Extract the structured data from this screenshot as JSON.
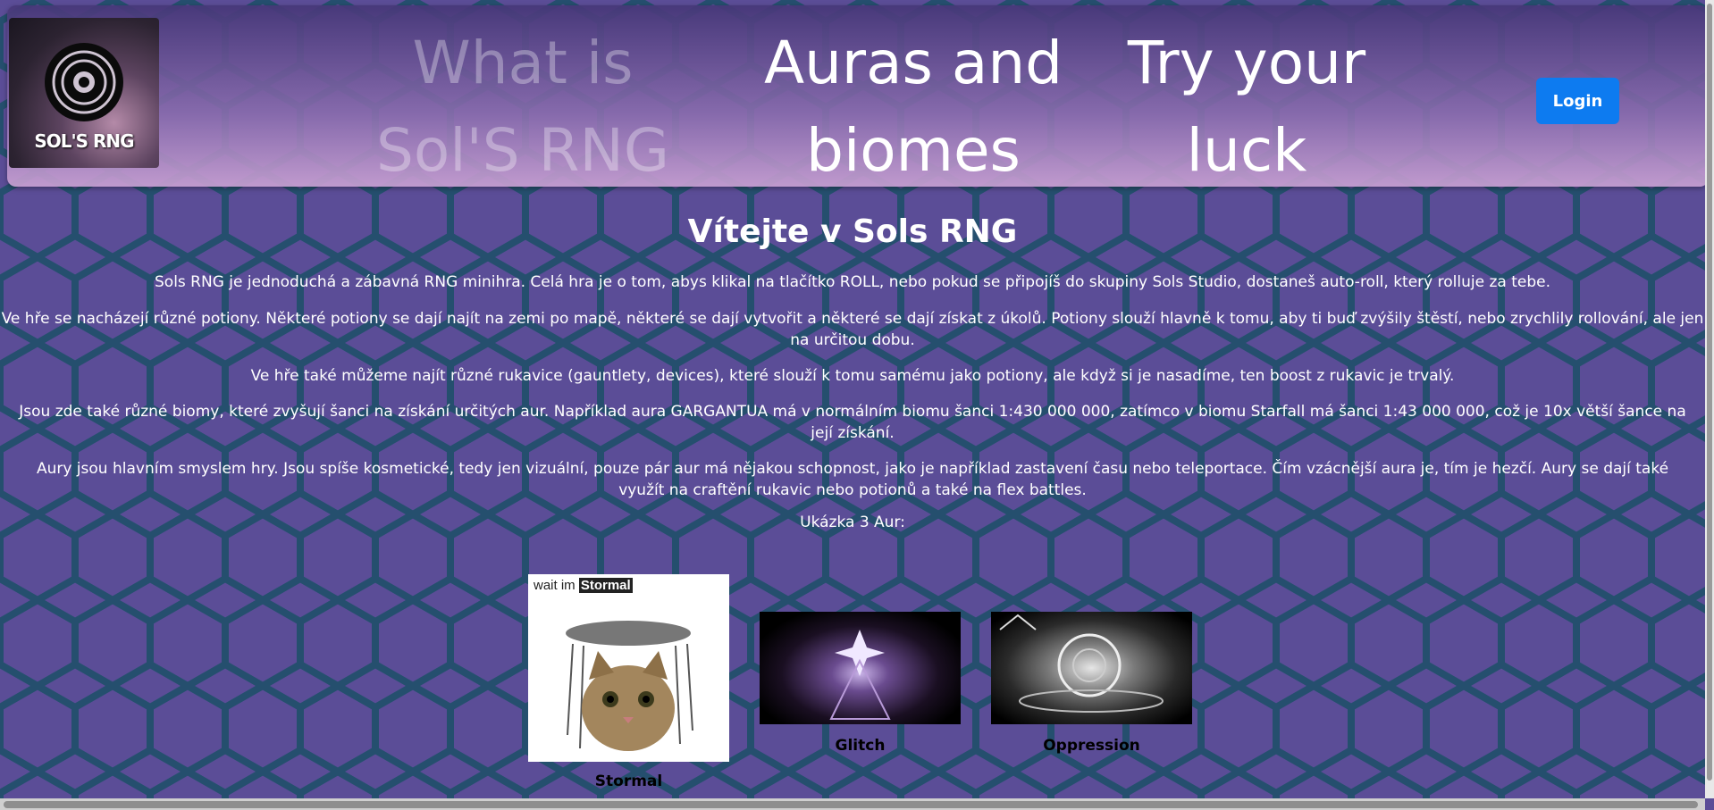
{
  "header": {
    "logo_text": "SOL'S RNG",
    "nav": [
      {
        "label": "What is Sol'S RNG"
      },
      {
        "label": "Auras and biomes"
      },
      {
        "label": "Try your luck"
      }
    ],
    "login_label": "Login",
    "colors": {
      "login_button": "#0d7bf0"
    }
  },
  "main": {
    "title": "Vítejte v Sols RNG",
    "paragraphs": [
      "Sols RNG je jednoduchá a zábavná RNG minihra. Celá hra je o tom, abys klikal na tlačítko ROLL, nebo pokud se připojíš do skupiny Sols Studio, dostaneš auto-roll, který rolluje za tebe.",
      "Ve hře se nacházejí různé potiony. Některé potiony se dají najít na zemi po mapě, některé se dají vytvořit a některé se dají získat z úkolů. Potiony slouží hlavně k tomu, aby ti buď zvýšily štěstí, nebo zrychlily rollování, ale jen na určitou dobu.",
      "Ve hře také můžeme najít různé rukavice (gauntlety, devices), které slouží k tomu samému jako potiony, ale když si je nasadíme, ten boost z rukavic je trvalý.",
      "Jsou zde také různé biomy, které zvyšují šanci na získání určitých aur. Například aura GARGANTUA má v normálním biomu šanci 1:430 000 000, zatímco v biomu Starfall má šanci 1:43 000 000, což je 10x větší šance na její získání.",
      "Aury jsou hlavním smyslem hry. Jsou spíše kosmetické, tedy jen vizuální, pouze pár aur má nějakou schopnost, jako je například zastavení času nebo teleportace. Čím vzácnější aura je, tím je hezčí. Aury se dají také využít na craftění rukavic nebo potionů a také na flex battles.",
      "Ukázka 3 Aur:"
    ],
    "auras": [
      {
        "name": "Stormal",
        "image_caption": "wait im",
        "image_highlight": "Stormal"
      },
      {
        "name": "Glitch"
      },
      {
        "name": "Oppression"
      }
    ]
  }
}
